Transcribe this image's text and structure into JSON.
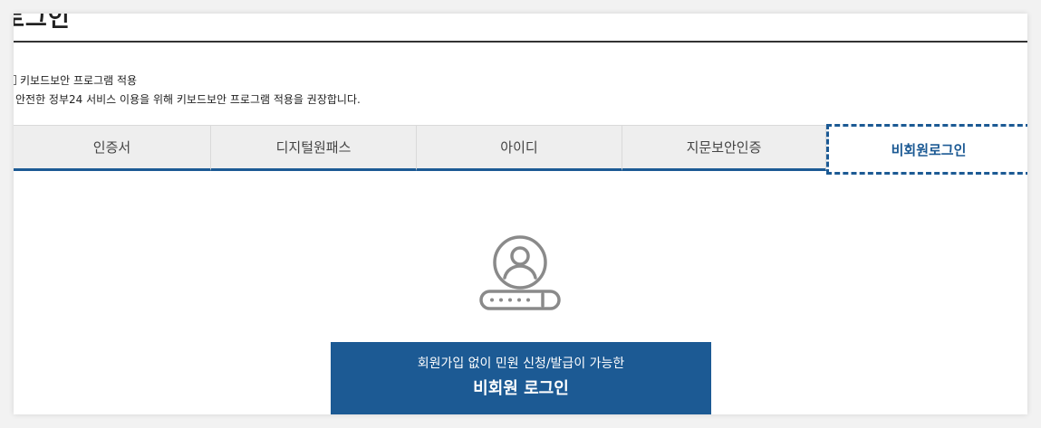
{
  "page": {
    "title": "로그인"
  },
  "keyboard_security": {
    "checkbox_label": "키보드보안 프로그램 적용",
    "description": "안전한 정부24 서비스 이용을 위해 키보드보안 프로그램 적용을 권장합니다."
  },
  "tabs": [
    {
      "label": "인증서"
    },
    {
      "label": "디지털원패스"
    },
    {
      "label": "아이디"
    },
    {
      "label": "지문보안인증"
    },
    {
      "label": "비회원로그인",
      "active": true
    }
  ],
  "guest_login": {
    "icon": "user-password-icon",
    "button_subtitle": "회원가입 없이 민원 신청/발급이 가능한",
    "button_label": "비회원 로그인"
  },
  "colors": {
    "accent": "#1c5a94",
    "tab_background": "#eeeeee",
    "icon_gray": "#8a8a8a"
  }
}
